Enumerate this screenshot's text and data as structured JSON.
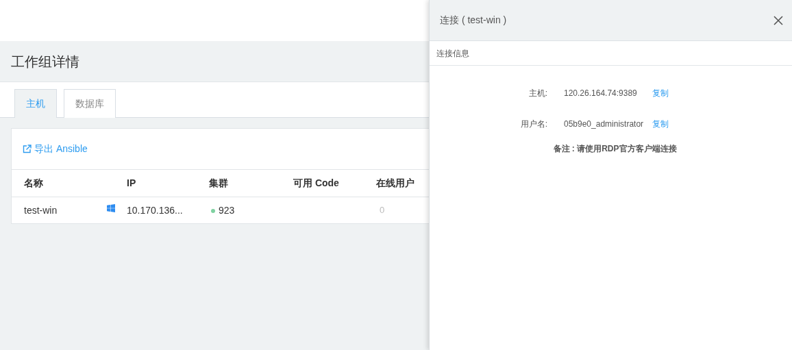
{
  "page": {
    "title": "工作组详情"
  },
  "tabs": [
    {
      "label": "主机",
      "selected": true
    },
    {
      "label": "数据库",
      "selected": false
    }
  ],
  "export_link": "导出 Ansible",
  "table": {
    "columns": [
      "名称",
      "IP",
      "集群",
      "可用 Code",
      "在线用户"
    ],
    "rows": [
      {
        "name": "test-win",
        "os_icon": true,
        "ip": "10.170.136...",
        "cluster": "923",
        "color": "#7fd1a1",
        "online_users": "0"
      }
    ]
  },
  "panel": {
    "title": "连接 ( test-win )",
    "section": "连接信息",
    "fields": [
      {
        "label": "主机:",
        "value": "120.26.164.74:9389",
        "action": "复制"
      },
      {
        "label": "用户名:",
        "value": "05b9e0_administrator",
        "action": "复制"
      }
    ],
    "note": "备注 : 请使用RDP官方客户端连接"
  }
}
